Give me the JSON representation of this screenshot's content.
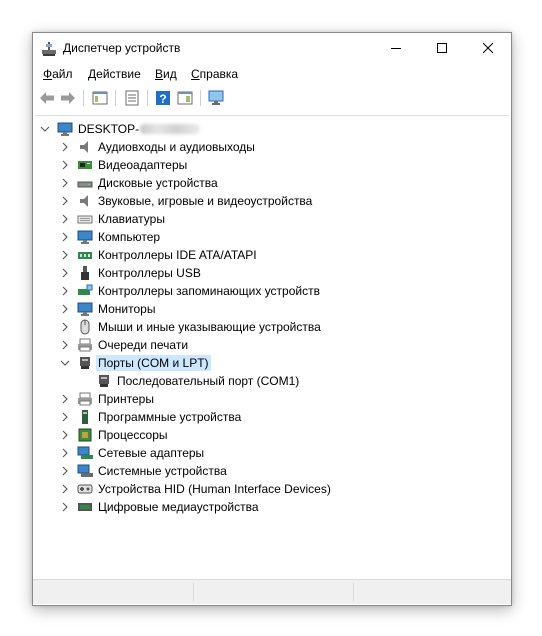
{
  "window": {
    "title": "Диспетчер устройств"
  },
  "menu": {
    "file": "Файл",
    "action": "Действие",
    "view": "Вид",
    "help": "Справка"
  },
  "tree": {
    "root": "DESKTOP-",
    "categories": [
      {
        "label": "Аудиовходы и аудиовыходы",
        "icon": "speaker-icon",
        "expanded": false
      },
      {
        "label": "Видеоадаптеры",
        "icon": "display-adapter-icon",
        "expanded": false
      },
      {
        "label": "Дисковые устройства",
        "icon": "disk-drive-icon",
        "expanded": false
      },
      {
        "label": "Звуковые, игровые и видеоустройства",
        "icon": "speaker-icon",
        "expanded": false
      },
      {
        "label": "Клавиатуры",
        "icon": "keyboard-icon",
        "expanded": false
      },
      {
        "label": "Компьютер",
        "icon": "computer-icon",
        "expanded": false
      },
      {
        "label": "Контроллеры IDE ATA/ATAPI",
        "icon": "ide-controller-icon",
        "expanded": false
      },
      {
        "label": "Контроллеры USB",
        "icon": "usb-icon",
        "expanded": false
      },
      {
        "label": "Контроллеры запоминающих устройств",
        "icon": "storage-controller-icon",
        "expanded": false
      },
      {
        "label": "Мониторы",
        "icon": "monitor-icon",
        "expanded": false
      },
      {
        "label": "Мыши и иные указывающие устройства",
        "icon": "mouse-icon",
        "expanded": false
      },
      {
        "label": "Очереди печати",
        "icon": "print-queue-icon",
        "expanded": false
      },
      {
        "label": "Порты (COM и LPT)",
        "icon": "port-icon",
        "expanded": true,
        "selected": true
      },
      {
        "label": "Принтеры",
        "icon": "printer-icon",
        "expanded": false
      },
      {
        "label": "Программные устройства",
        "icon": "software-device-icon",
        "expanded": false
      },
      {
        "label": "Процессоры",
        "icon": "processor-icon",
        "expanded": false
      },
      {
        "label": "Сетевые адаптеры",
        "icon": "network-adapter-icon",
        "expanded": false
      },
      {
        "label": "Системные устройства",
        "icon": "system-device-icon",
        "expanded": false
      },
      {
        "label": "Устройства HID (Human Interface Devices)",
        "icon": "hid-icon",
        "expanded": false
      },
      {
        "label": "Цифровые медиаустройства",
        "icon": "media-device-icon",
        "expanded": false
      }
    ],
    "child": {
      "label": "Последовательный порт (COM1)",
      "icon": "port-icon",
      "parent": "Порты (COM и LPT)"
    }
  },
  "colors": {
    "selection": "#cce8ff",
    "toolbar_blue": "#1f6fd1"
  }
}
